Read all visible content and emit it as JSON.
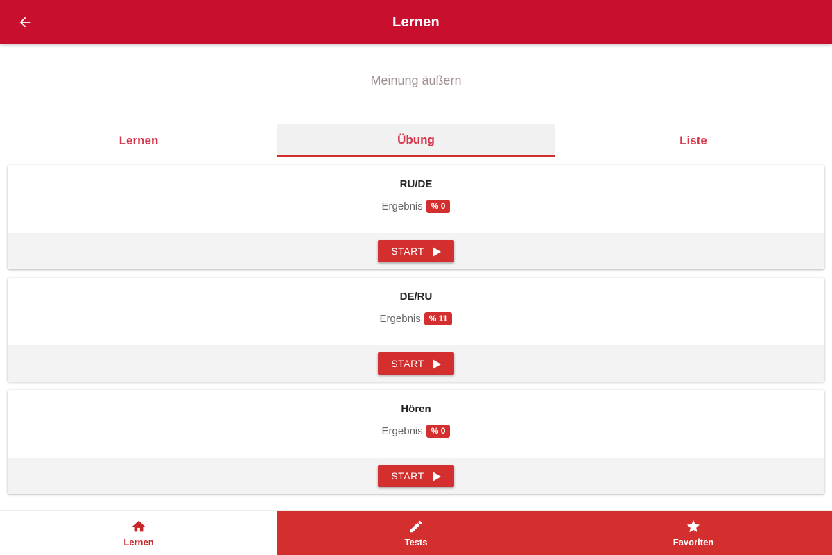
{
  "colors": {
    "primary": "#c8102e",
    "accent": "#d32f2f",
    "tab_text": "#d8344a",
    "subtitle": "#a08f8f"
  },
  "header": {
    "title": "Lernen",
    "back_icon": "arrow-left-icon"
  },
  "subtitle": "Meinung äußern",
  "tabs": [
    {
      "label": "Lernen",
      "active": false
    },
    {
      "label": "Übung",
      "active": true
    },
    {
      "label": "Liste",
      "active": false
    }
  ],
  "cards": [
    {
      "title": "RU/DE",
      "result_label": "Ergebnis",
      "result_value": "% 0",
      "button_label": "START",
      "button_icon": "play-icon"
    },
    {
      "title": "DE/RU",
      "result_label": "Ergebnis",
      "result_value": "% 11",
      "button_label": "START",
      "button_icon": "play-icon"
    },
    {
      "title": "Hören",
      "result_label": "Ergebnis",
      "result_value": "% 0",
      "button_label": "START",
      "button_icon": "play-icon"
    }
  ],
  "bottom_nav": [
    {
      "label": "Lernen",
      "icon": "home-icon",
      "active": true
    },
    {
      "label": "Tests",
      "icon": "pencil-icon",
      "active": false
    },
    {
      "label": "Favoriten",
      "icon": "star-icon",
      "active": false
    }
  ]
}
